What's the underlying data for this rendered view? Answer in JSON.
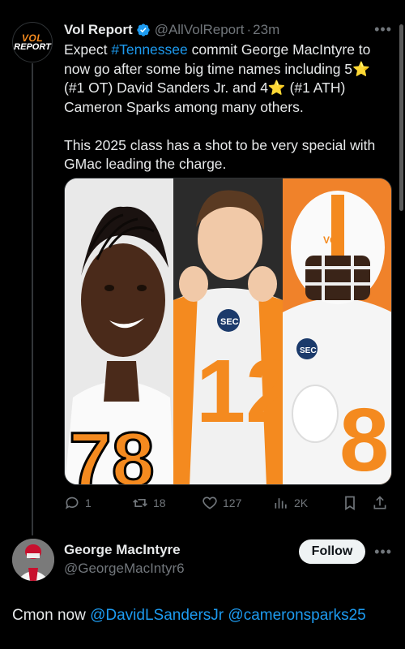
{
  "tweet": {
    "author_name": "Vol Report",
    "author_handle": "@AllVolReport",
    "separator": "·",
    "time": "23m",
    "avatar_text_top": "VOL",
    "avatar_text_bottom": "REPORT",
    "text_part1": "Expect ",
    "hashtag": "#Tennessee",
    "text_part2": " commit George MacIntyre to now go after some big time names including 5",
    "star": "⭐",
    "text_part3": " (#1 OT) David Sanders Jr. and 4",
    "text_part4": " (#1 ATH) Cameron Sparks among many others.\n\nThis 2025 class has a shot to be very special with GMac leading the charge.",
    "jersey_left": "78",
    "jersey_middle": "12",
    "jersey_right": "8",
    "helmet_text": "VOL"
  },
  "actions": {
    "replies": "1",
    "retweets": "18",
    "likes": "127",
    "views": "2K"
  },
  "reply": {
    "author_name": "George MacIntyre",
    "author_handle": "@GeorgeMacIntyr6",
    "follow_label": "Follow",
    "text_prefix": "Cmon now ",
    "mention1": "@DavidLSandersJr",
    "mention2": "@cameronsparks25"
  },
  "colors": {
    "accent": "#1d9bf0",
    "orange": "#f48a1f",
    "muted": "#71767b"
  }
}
